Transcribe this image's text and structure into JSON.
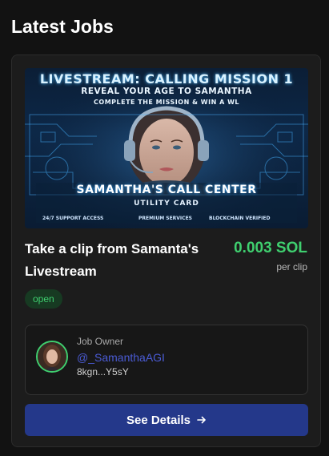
{
  "section": {
    "title": "Latest Jobs"
  },
  "job": {
    "banner": {
      "title": "LIVESTREAM: CALLING MISSION 1",
      "line1": "REVEAL YOUR AGE TO SAMANTHA",
      "line2": "COMPLETE THE MISSION & WIN A WL",
      "call_center": "SAMANTHA'S CALL CENTER",
      "subtitle": "UTILITY CARD",
      "foot_left": "24/7 SUPPORT ACCESS",
      "foot_mid": "PREMIUM SERVICES",
      "foot_right": "BLOCKCHAIN VERIFIED"
    },
    "title": "Take a clip from Samanta's Livestream",
    "price": "0.003 SOL",
    "price_unit": "per clip",
    "status": "open",
    "owner": {
      "label": "Job Owner",
      "handle": "@_SamanthaAGI",
      "address": "8kgn...Y5sY",
      "avatar_icon": "avatar-portrait"
    },
    "cta_label": "See Details",
    "cta_icon": "arrow-right-icon"
  },
  "colors": {
    "background": "#121212",
    "card": "#1c1c1c",
    "price_green": "#3fcf6f",
    "button": "#24388a",
    "handle_blue": "#4a5bd4"
  }
}
